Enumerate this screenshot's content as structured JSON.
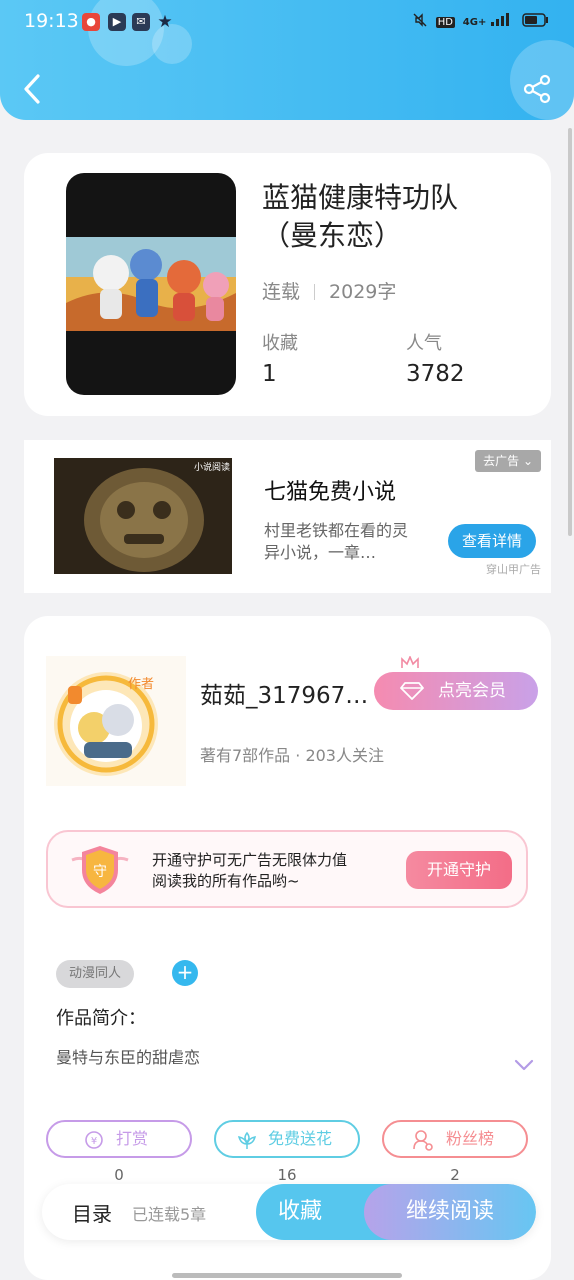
{
  "status_bar": {
    "time": "19:13",
    "network": "4G+"
  },
  "book": {
    "title": "蓝猫健康特功队（曼东恋）",
    "status": "连载",
    "word_count": "2029字",
    "favorites_label": "收藏",
    "favorites_value": "1",
    "popularity_label": "人气",
    "popularity_value": "3782"
  },
  "ad": {
    "title": "七猫免费小说",
    "description": "村里老铁都在看的灵异小说，一章…",
    "button_label": "查看详情",
    "close_label": "去广告",
    "source": "穿山甲广告",
    "image_caption": "小说阅读"
  },
  "author": {
    "badge": "作者",
    "name": "茹茹_317967…",
    "stats": "著有7部作品 · 203人关注",
    "vip_button": "点亮会员"
  },
  "guard": {
    "line1": "开通守护可无广告无限体力值",
    "line2": "阅读我的所有作品哟~",
    "button_label": "开通守护",
    "icon_char": "守"
  },
  "intro": {
    "tag": "动漫同人",
    "add_symbol": "+",
    "label": "作品简介：",
    "text": "曼特与东臣的甜虐恋"
  },
  "actions": [
    {
      "label": "打赏",
      "count": "0",
      "color": "#c69be8"
    },
    {
      "label": "免费送花",
      "count": "16",
      "color": "#5fcde3"
    },
    {
      "label": "粉丝榜",
      "count": "2",
      "color": "#f58e92"
    }
  ],
  "bottom": {
    "toc_label": "目录",
    "serial_info": "已连载5章",
    "favorite_button": "收藏",
    "continue_button": "继续阅读"
  }
}
